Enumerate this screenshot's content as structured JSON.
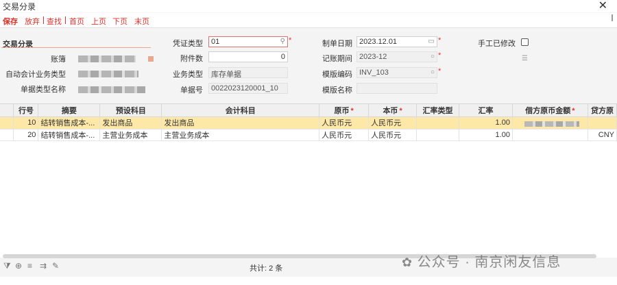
{
  "window": {
    "title": "交易分录"
  },
  "toolbar": {
    "items": [
      "保存",
      "放弃",
      "查找",
      "首页",
      "上页",
      "下页",
      "末页"
    ]
  },
  "form": {
    "section": "交易分录",
    "labels": {
      "ledger": "账簿",
      "auto_type": "自动会计业务类型",
      "doc_type_name": "单据类型名称",
      "voucher_type": "凭证类型",
      "attachments": "附件数",
      "biz_type": "业务类型",
      "doc_no": "单据号",
      "make_date": "制单日期",
      "period": "记账期间",
      "template_code": "模版编码",
      "template_name": "模版名称",
      "manual_edit": "手工已修改"
    },
    "values": {
      "voucher_type": "01",
      "attachments": "0",
      "biz_type": "库存单据",
      "doc_no": "0022023120001_10",
      "make_date": "2023.12.01",
      "period": "2023-12",
      "template_code": "INV_103",
      "template_name": ""
    }
  },
  "grid": {
    "columns": [
      "行号",
      "摘要",
      "预设科目",
      "会计科目",
      "原币",
      "本币",
      "汇率类型",
      "汇率",
      "借方原币金额",
      "贷方原"
    ],
    "required_columns": [
      4,
      5,
      8
    ],
    "rows": [
      {
        "no": "10",
        "summary": "结转销售成本-...",
        "preset": "发出商品",
        "account": "发出商品",
        "orig_currency": "人民币元",
        "local_currency": "人民币元",
        "rate_type": "",
        "rate": "1.00",
        "debit": "",
        "credit": ""
      },
      {
        "no": "20",
        "summary": "结转销售成本-...",
        "preset": "主营业务成本",
        "account": "主营业务成本",
        "orig_currency": "人民币元",
        "local_currency": "人民币元",
        "rate_type": "",
        "rate": "1.00",
        "debit": "",
        "credit": "CNY"
      }
    ]
  },
  "status": {
    "total": "共计: 2 条"
  },
  "watermark": {
    "text": "公众号 · 南京闲友信息"
  }
}
